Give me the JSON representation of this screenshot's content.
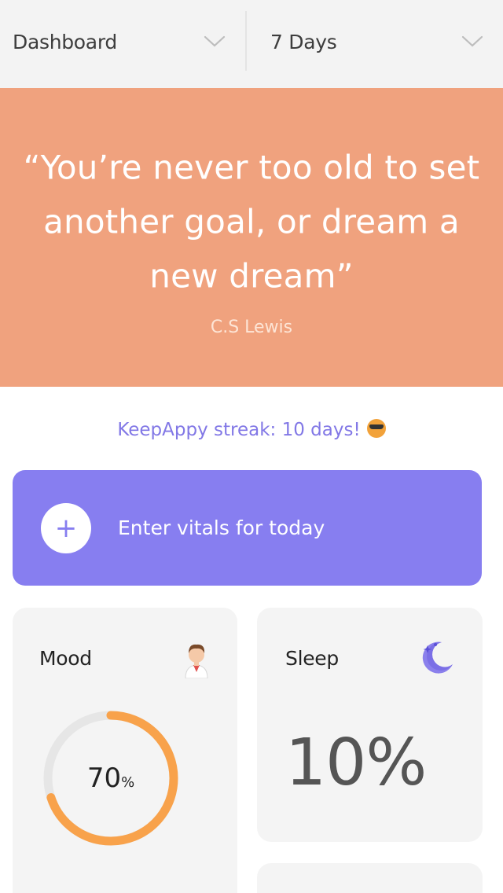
{
  "topbar": {
    "view_selector": {
      "label": "Dashboard",
      "icon": "chevron-down-icon"
    },
    "range_selector": {
      "label": "7 Days",
      "icon": "chevron-down-icon"
    }
  },
  "quote": {
    "text": "“You’re never too old to set another goal, or dream a new dream”",
    "author": "C.S Lewis",
    "background": "#f0a27e"
  },
  "streak": {
    "text": "KeepAppy streak: 10 days!",
    "emoji": "sunglasses-emoji-icon",
    "color": "#8278e6"
  },
  "vitals_button": {
    "label": "Enter vitals for today",
    "plus": "+",
    "background": "#877ef0"
  },
  "cards": {
    "mood": {
      "title": "Mood",
      "value": "70",
      "unit": "%",
      "progress": 0.7,
      "ring_color": "#f8a24b",
      "track_color": "#e6e6e6",
      "icon": "person-avatar-icon"
    },
    "sleep": {
      "title": "Sleep",
      "value": "10%",
      "icon": "moon-stars-icon"
    }
  }
}
